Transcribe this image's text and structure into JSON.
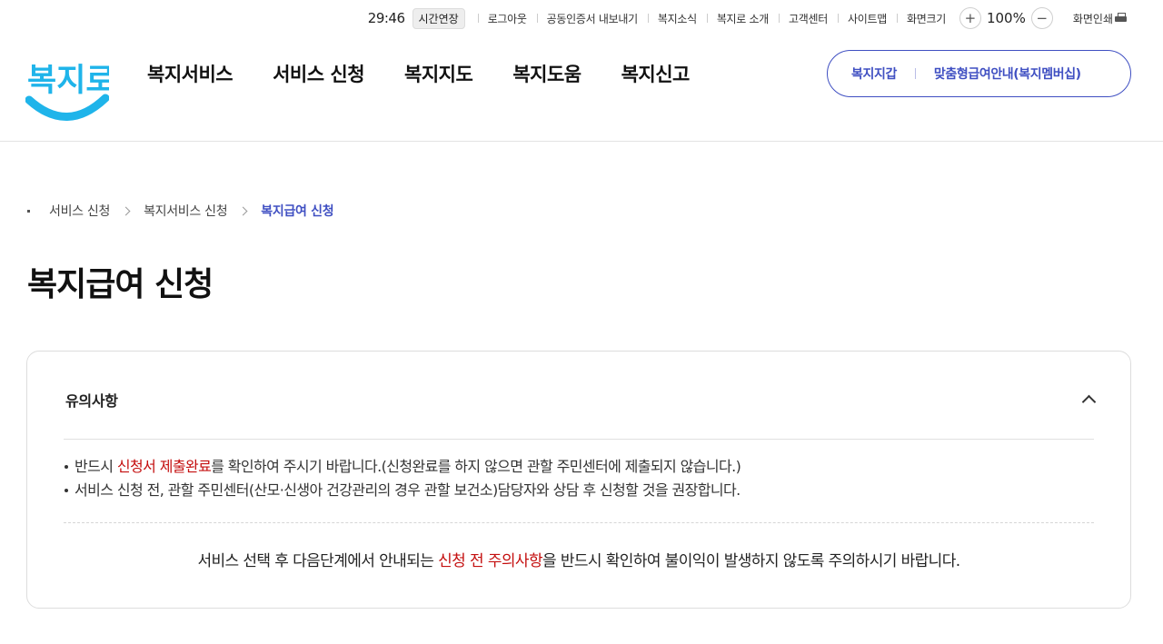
{
  "utility_bar": {
    "session_timer": "29:46",
    "extend_button": "시간연장",
    "links": [
      "로그아웃",
      "공동인증서 내보내기",
      "복지소식",
      "복지로 소개",
      "고객센터",
      "사이트맵",
      "화면크기"
    ],
    "zoom_in": "+",
    "zoom_level": "100%",
    "zoom_out": "−",
    "print_label": "화면인쇄"
  },
  "logo": {
    "text": "복지로",
    "color": "#1fb4ea"
  },
  "nav": {
    "items": [
      "복지서비스",
      "서비스 신청",
      "복지지도",
      "복지도움",
      "복지신고"
    ]
  },
  "quick_links": [
    "복지지갑",
    "맞춤형급여안내(복지멤버십)"
  ],
  "breadcrumb": [
    "서비스 신청",
    "복지서비스 신청",
    "복지급여 신청"
  ],
  "page_title": "복지급여 신청",
  "notice": {
    "heading": "유의사항",
    "bullet1": {
      "before": "반드시 ",
      "highlight": "신청서 제출완료",
      "after": "를 확인하여 주시기 바랍니다.(신청완료를 하지 않으면 관할 주민센터에 제출되지 않습니다.)"
    },
    "bullet2": "서비스 신청 전, 관할 주민센터(산모·신생아 건강관리의 경우 관할 보건소)담당자와 상담 후 신청할 것을 권장합니다.",
    "bottom": {
      "before": "서비스 선택 후 다음단계에서 안내되는 ",
      "highlight": "신청 전 주의사항",
      "after": "을 반드시 확인하여 불이익이 발생하지 않도록 주의하시기 바랍니다."
    }
  },
  "colors": {
    "brand_blue": "#3f4fc2",
    "warning_red": "#c40f0f",
    "logo_cyan": "#1fb4ea"
  }
}
